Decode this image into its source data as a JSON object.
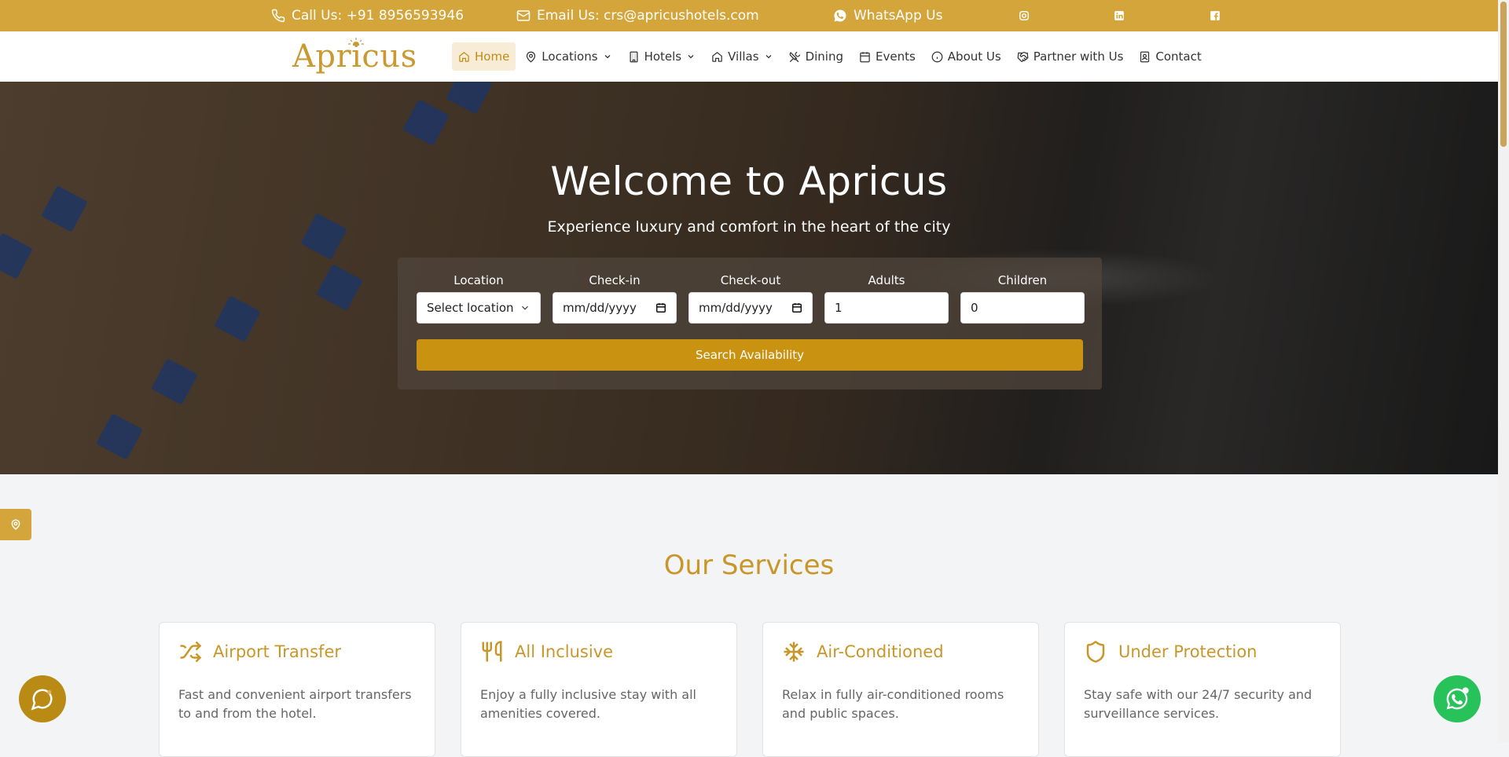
{
  "topbar": {
    "phone": "Call Us: +91 8956593946",
    "email": "Email Us: crs@apricushotels.com",
    "whatsapp": "WhatsApp Us",
    "socials": [
      "instagram-icon",
      "linkedin-icon",
      "facebook-icon"
    ]
  },
  "brand": {
    "logo_text": "Apricus"
  },
  "nav": [
    {
      "label": "Home",
      "icon": "home-icon",
      "active": true
    },
    {
      "label": "Locations",
      "icon": "map-pin-icon",
      "dropdown": true
    },
    {
      "label": "Hotels",
      "icon": "building-icon",
      "dropdown": true
    },
    {
      "label": "Villas",
      "icon": "house-icon",
      "dropdown": true
    },
    {
      "label": "Dining",
      "icon": "utensils-icon"
    },
    {
      "label": "Events",
      "icon": "calendar-icon"
    },
    {
      "label": "About Us",
      "icon": "info-icon"
    },
    {
      "label": "Partner with Us",
      "icon": "handshake-icon"
    },
    {
      "label": "Contact",
      "icon": "contact-icon"
    }
  ],
  "hero": {
    "title": "Welcome to Apricus",
    "subtitle": "Experience luxury and comfort in the heart of the city"
  },
  "search": {
    "location_label": "Location",
    "location_value": "Select location",
    "checkin_label": "Check-in",
    "checkin_value": "mm/dd/yyyy",
    "checkout_label": "Check-out",
    "checkout_value": "mm/dd/yyyy",
    "adults_label": "Adults",
    "adults_value": "1",
    "children_label": "Children",
    "children_value": "0",
    "button": "Search Availability"
  },
  "services": {
    "title": "Our Services",
    "items": [
      {
        "title": "Airport Transfer",
        "desc": "Fast and convenient airport transfers to and from the hotel.",
        "icon": "shuffle-icon"
      },
      {
        "title": "All Inclusive",
        "desc": "Enjoy a fully inclusive stay with all amenities covered.",
        "icon": "utensils-icon"
      },
      {
        "title": "Air-Conditioned",
        "desc": "Relax in fully air-conditioned rooms and public spaces.",
        "icon": "snowflake-icon"
      },
      {
        "title": "Under Protection",
        "desc": "Stay safe with our 24/7 security and surveillance services.",
        "icon": "shield-icon"
      }
    ]
  },
  "colors": {
    "gold": "#d4a53a",
    "gold_dark": "#c99210",
    "whatsapp": "#27c35a"
  }
}
